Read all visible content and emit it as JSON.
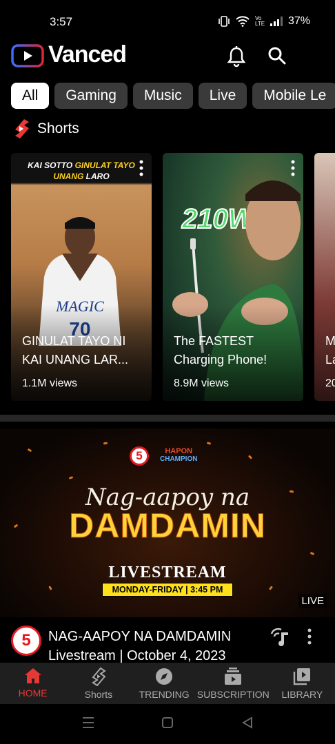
{
  "status_bar": {
    "time": "3:57",
    "network": "Vo LTE",
    "battery": "37%"
  },
  "header": {
    "brand": "Vanced"
  },
  "chips": [
    "All",
    "Gaming",
    "Music",
    "Live",
    "Mobile Le"
  ],
  "shorts": {
    "section_title": "Shorts",
    "items": [
      {
        "banner_white": "KAI SOTTO ",
        "banner_yellow_1": "GINULAT TAYO",
        "banner_yellow_2": "UNANG",
        "banner_white_2": " LARO",
        "title": "GINULAT TAYO NI KAI UNANG LAR...",
        "views": "1.1M views"
      },
      {
        "overlay": "210W",
        "title": "The FASTEST Charging Phone!",
        "views": "8.9M views"
      },
      {
        "title_peek": "M La",
        "views_peek": "20"
      }
    ]
  },
  "video": {
    "network_badge": "5",
    "program_line1": "HAPON",
    "program_line2": "CHAMPION",
    "script_title": "Nag-aapoy na",
    "big_title": "DAMDAMIN",
    "livestream": "LIVESTREAM",
    "schedule": "MONDAY-FRIDAY | 3:45 PM",
    "live_badge": "LIVE",
    "channel_avatar": "5",
    "title": "NAG-AAPOY NA DAMDAMIN Livestream | October 4, 2023"
  },
  "bottom_nav": [
    {
      "label": "HOME",
      "icon": "home-icon",
      "active": true
    },
    {
      "label": "Shorts",
      "icon": "shorts-icon"
    },
    {
      "label": "TRENDING",
      "icon": "trending-icon"
    },
    {
      "label": "SUBSCRIPTION",
      "icon": "subscription-icon"
    },
    {
      "label": "LIBRARY",
      "icon": "library-icon"
    }
  ],
  "colors": {
    "accent": "#e53935",
    "chip_bg": "#3a3a3a",
    "nav_bg": "#1f1f1f"
  }
}
